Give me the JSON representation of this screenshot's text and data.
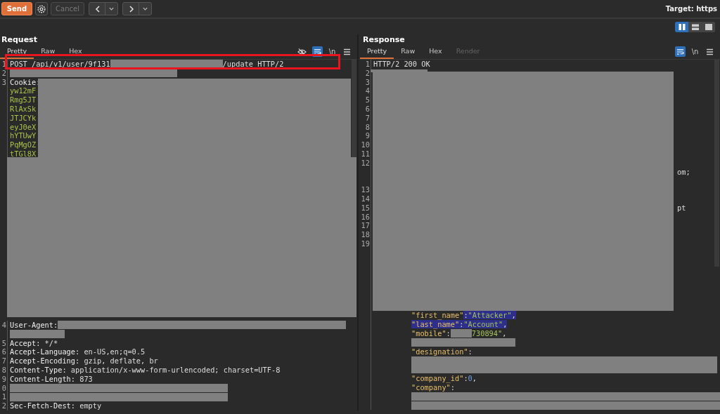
{
  "toolbar": {
    "send": {
      "label": "Send"
    },
    "cancel": {
      "label": "Cancel",
      "disabled": true
    },
    "target": "Target: https"
  },
  "layout_toggles": [
    {
      "kind": "columns",
      "selected": true
    },
    {
      "kind": "rows",
      "selected": false
    },
    {
      "kind": "single",
      "selected": false
    }
  ],
  "request": {
    "title": "Request",
    "tabs": [
      {
        "label": "Pretty",
        "selected": true,
        "disabled": false
      },
      {
        "label": "Raw",
        "selected": false,
        "disabled": false
      },
      {
        "label": "Hex",
        "selected": false,
        "disabled": false
      }
    ],
    "tools": [
      {
        "kind": "hide",
        "selected": false
      },
      {
        "kind": "wrap",
        "selected": true
      },
      {
        "kind": "newline",
        "text": "\\n",
        "selected": false
      },
      {
        "kind": "menu",
        "selected": false
      }
    ],
    "top_rows": [
      {
        "number": "1",
        "segments": [
          {
            "kind": "value",
            "text": "POST /api/v1/user/9f131"
          },
          {
            "kind": "redacted"
          },
          {
            "kind": "value",
            "text": "/update HTTP/2"
          }
        ]
      },
      {
        "number": "2",
        "segments": [
          {
            "kind": "redacted"
          }
        ]
      },
      {
        "number": "3",
        "segments": [
          {
            "kind": "key",
            "text": "Cookie:"
          }
        ]
      },
      {
        "segments": [
          {
            "kind": "cookie",
            "text": "yw12mF"
          }
        ]
      },
      {
        "segments": [
          {
            "kind": "cookie",
            "text": "Rmg5JT"
          }
        ]
      },
      {
        "segments": [
          {
            "kind": "cookie",
            "text": "RlAxSk"
          }
        ]
      },
      {
        "segments": [
          {
            "kind": "cookie",
            "text": "JTJCYk"
          }
        ]
      },
      {
        "segments": [
          {
            "kind": "cookie",
            "text": "eyJ0eX"
          }
        ]
      },
      {
        "segments": [
          {
            "kind": "cookie",
            "text": "hYTUwY"
          }
        ]
      },
      {
        "segments": [
          {
            "kind": "cookie",
            "text": "PqMgOZ"
          }
        ]
      },
      {
        "segments": [
          {
            "kind": "cookie",
            "text": "tTGl8X"
          }
        ]
      }
    ],
    "bottom_rows": [
      {
        "number": "4",
        "segments": [
          {
            "kind": "key",
            "text": "User-Agent:"
          },
          {
            "kind": "redacted"
          }
        ]
      },
      {
        "segments": [
          {
            "kind": "redacted"
          }
        ]
      },
      {
        "number": "5",
        "segments": [
          {
            "kind": "key",
            "text": "Accept:"
          },
          {
            "kind": "value",
            "text": " */*"
          }
        ]
      },
      {
        "number": "6",
        "segments": [
          {
            "kind": "key",
            "text": "Accept-Language:"
          },
          {
            "kind": "value",
            "text": " en-US,en;q=0.5"
          }
        ]
      },
      {
        "number": "7",
        "segments": [
          {
            "kind": "key",
            "text": "Accept-Encoding:"
          },
          {
            "kind": "value",
            "text": " gzip, deflate, br"
          }
        ]
      },
      {
        "number": "8",
        "segments": [
          {
            "kind": "key",
            "text": "Content-Type:"
          },
          {
            "kind": "value",
            "text": " application/x-www-form-urlencoded; charset=UTF-8"
          }
        ]
      },
      {
        "number": "9",
        "segments": [
          {
            "kind": "key",
            "text": "Content-Length:"
          },
          {
            "kind": "value",
            "text": " 873"
          }
        ]
      },
      {
        "number": "0",
        "segments": [
          {
            "kind": "redacted"
          }
        ]
      },
      {
        "number": "1",
        "segments": [
          {
            "kind": "redacted"
          }
        ]
      },
      {
        "number": "2",
        "segments": [
          {
            "kind": "key",
            "text": "Sec-Fetch-Dest:"
          },
          {
            "kind": "value",
            "text": " empty"
          }
        ]
      }
    ]
  },
  "response": {
    "title": "Response",
    "tabs": [
      {
        "label": "Pretty",
        "selected": true,
        "disabled": false
      },
      {
        "label": "Raw",
        "selected": false,
        "disabled": false
      },
      {
        "label": "Hex",
        "selected": false,
        "disabled": false
      },
      {
        "label": "Render",
        "selected": false,
        "disabled": true
      }
    ],
    "tools": [
      {
        "kind": "wrap",
        "selected": true
      },
      {
        "kind": "newline",
        "text": "\\n",
        "selected": false
      },
      {
        "kind": "menu",
        "selected": false
      }
    ],
    "rows": [
      {
        "number": "1",
        "segments": [
          {
            "kind": "value",
            "text": "HTTP/2 200 OK"
          }
        ]
      },
      {
        "number": "2"
      },
      {
        "number": "3"
      },
      {
        "number": "4"
      },
      {
        "number": "5"
      },
      {
        "number": "6"
      },
      {
        "number": "7"
      },
      {
        "number": "8"
      },
      {
        "number": "9"
      },
      {
        "number": "10"
      },
      {
        "number": "11"
      },
      {
        "number": "12"
      },
      {
        "segments": [
          {
            "kind": "tail",
            "text": "om;"
          }
        ]
      },
      {
        "kind": "blank"
      },
      {
        "number": "13"
      },
      {
        "number": "14"
      },
      {
        "number": "15",
        "segments": [
          {
            "kind": "tail",
            "text": "pt"
          }
        ]
      },
      {
        "number": "16"
      },
      {
        "number": "17"
      },
      {
        "number": "18"
      },
      {
        "number": "19"
      },
      {
        "kind": "blank"
      },
      {
        "kind": "blank"
      },
      {
        "kind": "blank"
      },
      {
        "kind": "blank"
      },
      {
        "kind": "blank"
      },
      {
        "kind": "blank"
      },
      {
        "kind": "blank"
      },
      {
        "kind": "json",
        "segments": [
          {
            "kind": "json-key",
            "text": "\"first_name\"",
            "highlighted": false
          },
          {
            "kind": "punct",
            "text": ":",
            "highlighted": true
          },
          {
            "kind": "json-string",
            "text": "\"Attacker\"",
            "highlighted": true
          },
          {
            "kind": "punct",
            "text": ",",
            "highlighted": true
          }
        ]
      },
      {
        "kind": "json",
        "segments": [
          {
            "kind": "json-key",
            "text": "\"last_name\"",
            "highlighted": true
          },
          {
            "kind": "punct",
            "text": ":",
            "highlighted": true
          },
          {
            "kind": "json-string",
            "text": "\"Account\"",
            "highlighted": true
          },
          {
            "kind": "punct",
            "text": ",",
            "highlighted": true
          }
        ]
      },
      {
        "kind": "json",
        "segments": [
          {
            "kind": "json-key",
            "text": "\"mobile\""
          },
          {
            "kind": "punct",
            "text": ":"
          },
          {
            "kind": "redacted"
          },
          {
            "kind": "json-string",
            "text": "730894\""
          },
          {
            "kind": "punct",
            "text": ","
          }
        ]
      },
      {
        "kind": "json",
        "segments": [
          {
            "kind": "redacted"
          }
        ]
      },
      {
        "kind": "json",
        "segments": [
          {
            "kind": "json-key",
            "text": "\"designation\""
          },
          {
            "kind": "punct",
            "text": ":"
          }
        ]
      },
      {
        "kind": "json",
        "segments": [
          {
            "kind": "redacted"
          }
        ]
      },
      {
        "kind": "json",
        "segments": [
          {
            "kind": "redacted"
          }
        ]
      },
      {
        "kind": "json",
        "segments": [
          {
            "kind": "json-key",
            "text": "\"company_id\""
          },
          {
            "kind": "punct",
            "text": ":"
          },
          {
            "kind": "json-number",
            "text": "0"
          },
          {
            "kind": "punct",
            "text": ","
          }
        ]
      },
      {
        "kind": "json",
        "segments": [
          {
            "kind": "json-key",
            "text": "\"company\""
          },
          {
            "kind": "punct",
            "text": ":"
          }
        ]
      },
      {
        "kind": "json",
        "segments": [
          {
            "kind": "redacted"
          }
        ]
      },
      {
        "kind": "json",
        "segments": [
          {
            "kind": "redacted"
          }
        ]
      }
    ]
  }
}
